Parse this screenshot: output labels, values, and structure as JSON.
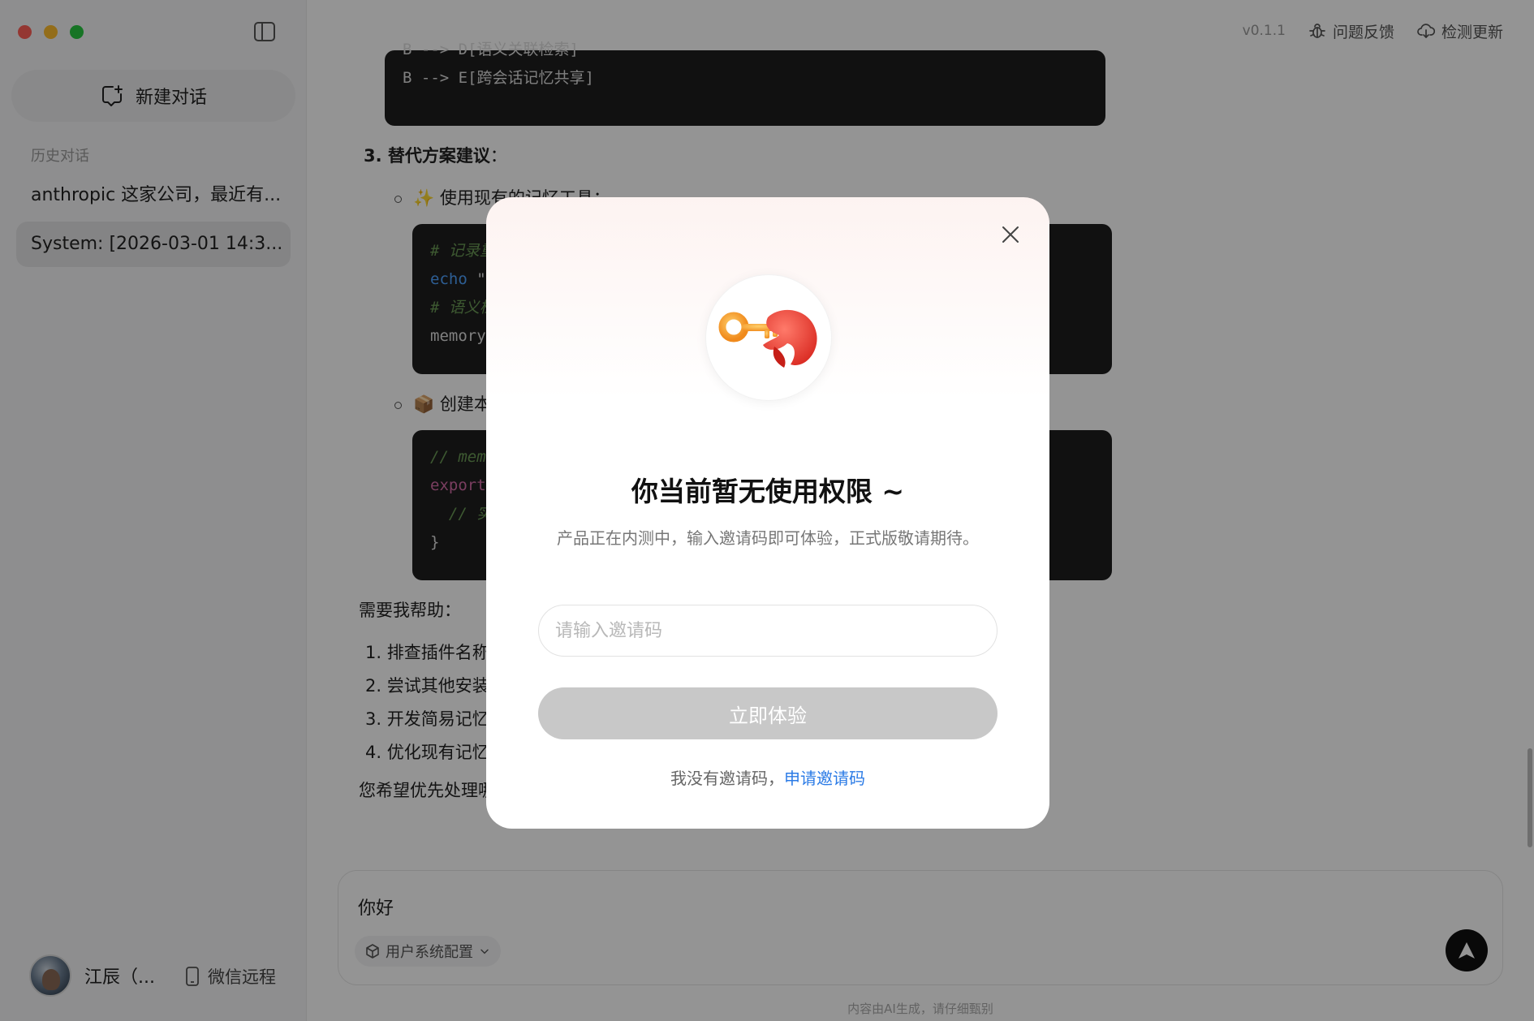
{
  "window": {
    "controls": [
      "close",
      "minimize",
      "zoom"
    ],
    "colors": {
      "close": "#ff5f57",
      "minimize": "#febc2e",
      "zoom": "#28c840"
    }
  },
  "sidebar": {
    "new_chat_label": "新建对话",
    "history_label": "历史对话",
    "history": [
      {
        "label": "anthropic 这家公司，最近有...",
        "active": false
      },
      {
        "label": "System: [2026-03-01 14:3...",
        "active": true
      }
    ],
    "user_name": "江辰（...",
    "wechat_label": "微信远程"
  },
  "topbar": {
    "version": "v0.1.1",
    "feedback_label": "问题反馈",
    "update_label": "检测更新"
  },
  "chat": {
    "code_block_1": [
      "B --> D[语义关联检索]",
      "B --> E[跨会话记忆共享]"
    ],
    "section_3_title": "3. 替代方案建议",
    "section_3_colon": "：",
    "bullet_1_icon": "✨",
    "bullet_1_text": "使用现有的记忆工具：",
    "code_block_2": {
      "line1": "# 记录重",
      "line2_kw": "echo",
      "line2_rest": " \"",
      "line3": "# 语义检",
      "line4": "memory"
    },
    "bullet_2_icon": "📦",
    "bullet_2_text": "创建本",
    "code_block_3": {
      "line1": "// mem",
      "line2_kw": "export",
      "line3": "  // 实",
      "line4": "}"
    },
    "help_intro": "需要我帮助：",
    "help_items": [
      "1. 排查插件名称",
      "2. 尝试其他安装",
      "3. 开发简易记忆",
      "4. 优化现有记忆"
    ],
    "closing_question": "您希望优先处理哪"
  },
  "composer": {
    "input_text": "你好",
    "config_chip_label": "用户系统配置"
  },
  "disclaimer": "内容由AI生成，请仔细甄别",
  "modal": {
    "title": "你当前暂无使用权限 ~",
    "description": "产品正在内测中，输入邀请码即可体验，正式版敬请期待。",
    "invite_placeholder": "请输入邀请码",
    "invite_value": "",
    "submit_label": "立即体验",
    "no_code_text": "我没有邀请码，",
    "apply_link_label": "申请邀请码",
    "accent_color": "#2b7be6",
    "disabled_button_color": "#c8c8c8"
  }
}
